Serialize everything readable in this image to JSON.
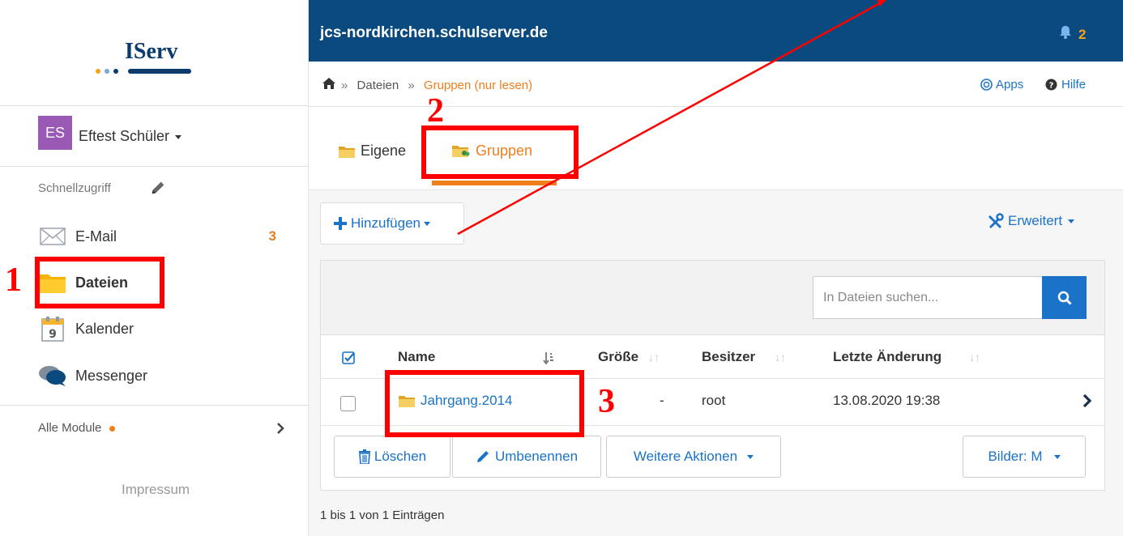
{
  "app": {
    "logo": "IServ",
    "domain": "jcs-nordkirchen.schulserver.de",
    "notification_count": "2"
  },
  "breadcrumb": {
    "items": [
      "Dateien",
      "Gruppen (nur lesen)"
    ],
    "separator": "»"
  },
  "header_links": {
    "apps": "Apps",
    "help": "Hilfe"
  },
  "user": {
    "initials": "ES",
    "name": "Eftest Schüler"
  },
  "sidebar": {
    "quick_access": "Schnellzugriff",
    "items": [
      {
        "label": "E-Mail",
        "badge": "3",
        "icon": "mail-icon"
      },
      {
        "label": "Dateien",
        "icon": "folder-icon"
      },
      {
        "label": "Kalender",
        "icon": "calendar-icon",
        "icon_text": "9"
      },
      {
        "label": "Messenger",
        "icon": "chat-icon"
      }
    ],
    "all_modules": "Alle Module",
    "imprint": "Impressum"
  },
  "tabs": [
    {
      "label": "Eigene",
      "active": false
    },
    {
      "label": "Gruppen",
      "active": true
    }
  ],
  "toolbar": {
    "add_label": "Hinzufügen",
    "advanced_label": "Erweitert"
  },
  "search": {
    "placeholder": "In Dateien suchen..."
  },
  "table": {
    "columns": [
      "Name",
      "Größe",
      "Besitzer",
      "Letzte Änderung"
    ],
    "rows": [
      {
        "name": "Jahrgang.2014",
        "size": "-",
        "owner": "root",
        "modified": "13.08.2020 19:38"
      }
    ]
  },
  "actions": {
    "delete": "Löschen",
    "rename": "Umbenennen",
    "more": "Weitere Aktionen",
    "images": "Bilder: M"
  },
  "pagination_info": "1 bis 1 von 1 Einträgen",
  "annotations": [
    "1",
    "2",
    "3"
  ],
  "colors": {
    "header_bg": "#0b4a7f",
    "accent_orange": "#f07e1b",
    "link_blue": "#1a73c8",
    "annotation_red": "#ff0000",
    "avatar_purple": "#9b59b6"
  }
}
